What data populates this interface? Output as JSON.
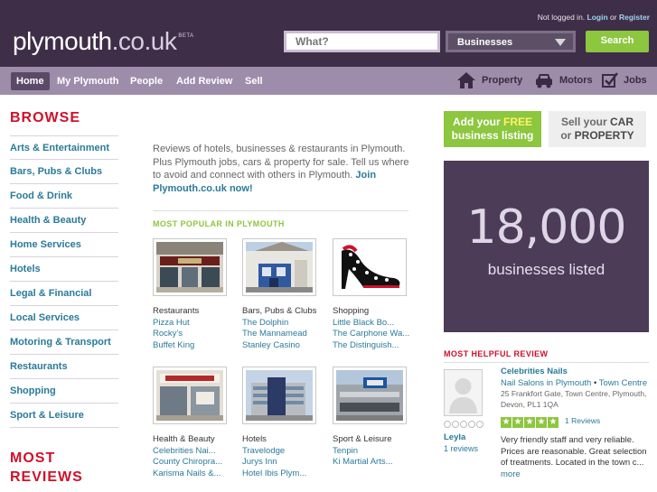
{
  "header": {
    "auth_status": "Not logged in.",
    "login_label": "Login",
    "or_label": "or",
    "register_label": "Register",
    "logo_main": "plymouth",
    "logo_tld": ".co.uk",
    "logo_badge": "BETA",
    "search_placeholder": "What?",
    "category_selected": "Businesses",
    "search_button": "Search"
  },
  "nav": {
    "items": [
      {
        "label": "Home",
        "active": true
      },
      {
        "label": "My Plymouth"
      },
      {
        "label": "People"
      },
      {
        "label": "Add Review"
      },
      {
        "label": "Sell"
      }
    ],
    "right": [
      {
        "label": "Property",
        "icon": "house-icon"
      },
      {
        "label": "Motors",
        "icon": "car-icon"
      },
      {
        "label": "Jobs",
        "icon": "checkbox-icon"
      }
    ]
  },
  "sidebar": {
    "heading": "BROWSE",
    "items": [
      {
        "label": "Arts & Entertainment"
      },
      {
        "label": "Bars, Pubs & Clubs"
      },
      {
        "label": "Food & Drink"
      },
      {
        "label": "Health & Beauty"
      },
      {
        "label": "Home Services"
      },
      {
        "label": "Hotels"
      },
      {
        "label": "Legal & Financial"
      },
      {
        "label": "Local Services"
      },
      {
        "label": "Motoring & Transport"
      },
      {
        "label": "Restaurants"
      },
      {
        "label": "Shopping"
      },
      {
        "label": "Sport & Leisure"
      }
    ],
    "most_reviews_line1": "MOST",
    "most_reviews_line2": "REVIEWS"
  },
  "intro": {
    "text": "Reviews of hotels, businesses & restaurants in Plymouth. Plus Plymouth jobs, cars & property for sale. Tell us where to avoid and connect with others in Plymouth.",
    "join": "Join Plymouth.co.uk now!"
  },
  "popular": {
    "heading": "MOST POPULAR IN PLYMOUTH",
    "tiles": [
      {
        "category": "Restaurants",
        "image": "restaurant-photo",
        "businesses": [
          "Pizza Hut",
          "Rocky's",
          "Buffet King"
        ]
      },
      {
        "category": "Bars, Pubs & Clubs",
        "image": "pub-photo",
        "businesses": [
          "The Dolphin",
          "The Mannamead",
          "Stanley Casino"
        ]
      },
      {
        "category": "Shopping",
        "image": "shoe-photo",
        "businesses": [
          "Little Black Bo...",
          "The Carphone Wa...",
          "The Distinguish..."
        ]
      },
      {
        "category": "Health & Beauty",
        "image": "salon-photo",
        "businesses": [
          "Celebrities Nai...",
          "County Chiropra...",
          "Karisma Nails &..."
        ]
      },
      {
        "category": "Hotels",
        "image": "hotel-photo",
        "businesses": [
          "Travelodge",
          "Jurys Inn",
          "Hotel Ibis Plym..."
        ]
      },
      {
        "category": "Sport & Leisure",
        "image": "sport-photo",
        "businesses": [
          "Tenpin",
          "Ki Martial Arts..."
        ]
      }
    ]
  },
  "cta": {
    "green_pre": "Add your",
    "green_highlight": "FREE",
    "green_post": "business listing",
    "grey_pre": "Sell your",
    "grey_car": "CAR",
    "grey_or": "or",
    "grey_property": "PROPERTY"
  },
  "stats": {
    "count": "18,000",
    "label": "businesses listed"
  },
  "review": {
    "heading": "MOST HELPFUL REVIEW",
    "reviewer": "Leyla",
    "reviewer_reviews": "1 reviews",
    "business": "Celebrities Nails",
    "category_link": "Nail Salons in Plymouth",
    "area_link": "Town Centre",
    "address": "25 Frankfort Gate, Town Centre, Plymouth, Devon, PL1 1QA",
    "rating": 5,
    "rating_count": "1 Reviews",
    "text": "Very friendly staff and very reliable. Prices are reasonable. Great selection of treatments. Located in the town c...",
    "more": "more"
  },
  "colors": {
    "header_bg": "#3f2e48",
    "nav_bg": "#9d8daa",
    "accent_green": "#8dc63f",
    "heading_red": "#d0102a",
    "link_blue": "#2a7a9a",
    "stats_bg": "#4c3c58"
  }
}
